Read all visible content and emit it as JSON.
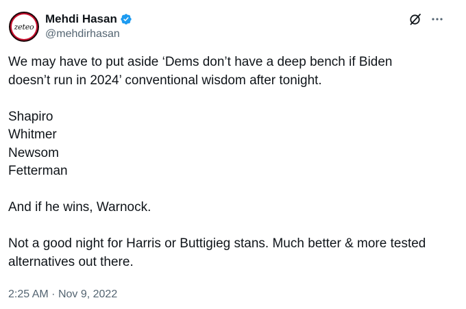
{
  "author": {
    "display_name": "Mehdi Hasan",
    "handle": "@mehdirhasan",
    "avatar_text": "zeteo",
    "verified": true,
    "verified_color": "#1d9bf0"
  },
  "actions": {
    "grok_icon": "grok-icon",
    "more_icon": "more-icon"
  },
  "tweet": {
    "paragraph_1_line_1": "We may have to put aside ‘Dems don’t have a deep bench if Biden",
    "paragraph_1_line_2": "doesn’t run in 2024’ conventional wisdom after tonight.",
    "names": [
      "Shapiro",
      "Whitmer",
      "Newsom",
      "Fetterman"
    ],
    "paragraph_3": "And if he wins, Warnock.",
    "paragraph_4_line_1": "Not a good night for Harris or Buttigieg stans. Much better & more tested",
    "paragraph_4_line_2": "alternatives out there."
  },
  "meta": {
    "time": "2:25 AM",
    "separator": "·",
    "date": "Nov 9, 2022"
  }
}
